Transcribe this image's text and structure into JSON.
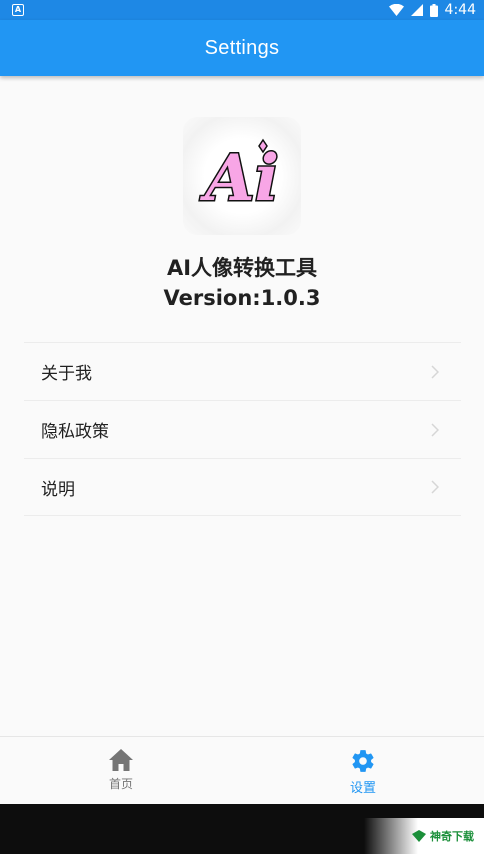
{
  "status_bar": {
    "time": "4:44"
  },
  "app_bar": {
    "title": "Settings"
  },
  "about": {
    "app_name": "AI人像转换工具",
    "version": "Version:1.0.3",
    "logo_text": "Ai"
  },
  "menu": {
    "items": [
      {
        "label": "关于我"
      },
      {
        "label": "隐私政策"
      },
      {
        "label": "说明"
      }
    ]
  },
  "bottom_nav": {
    "items": [
      {
        "label": "首页",
        "icon": "home-icon",
        "active": false
      },
      {
        "label": "设置",
        "icon": "gear-icon",
        "active": true
      }
    ]
  },
  "watermark": {
    "text": "神奇下载"
  },
  "colors": {
    "primary": "#2196f3",
    "status_bar": "#1e88e5",
    "inactive": "#757575",
    "logo_fill": "#f8a6e6"
  }
}
